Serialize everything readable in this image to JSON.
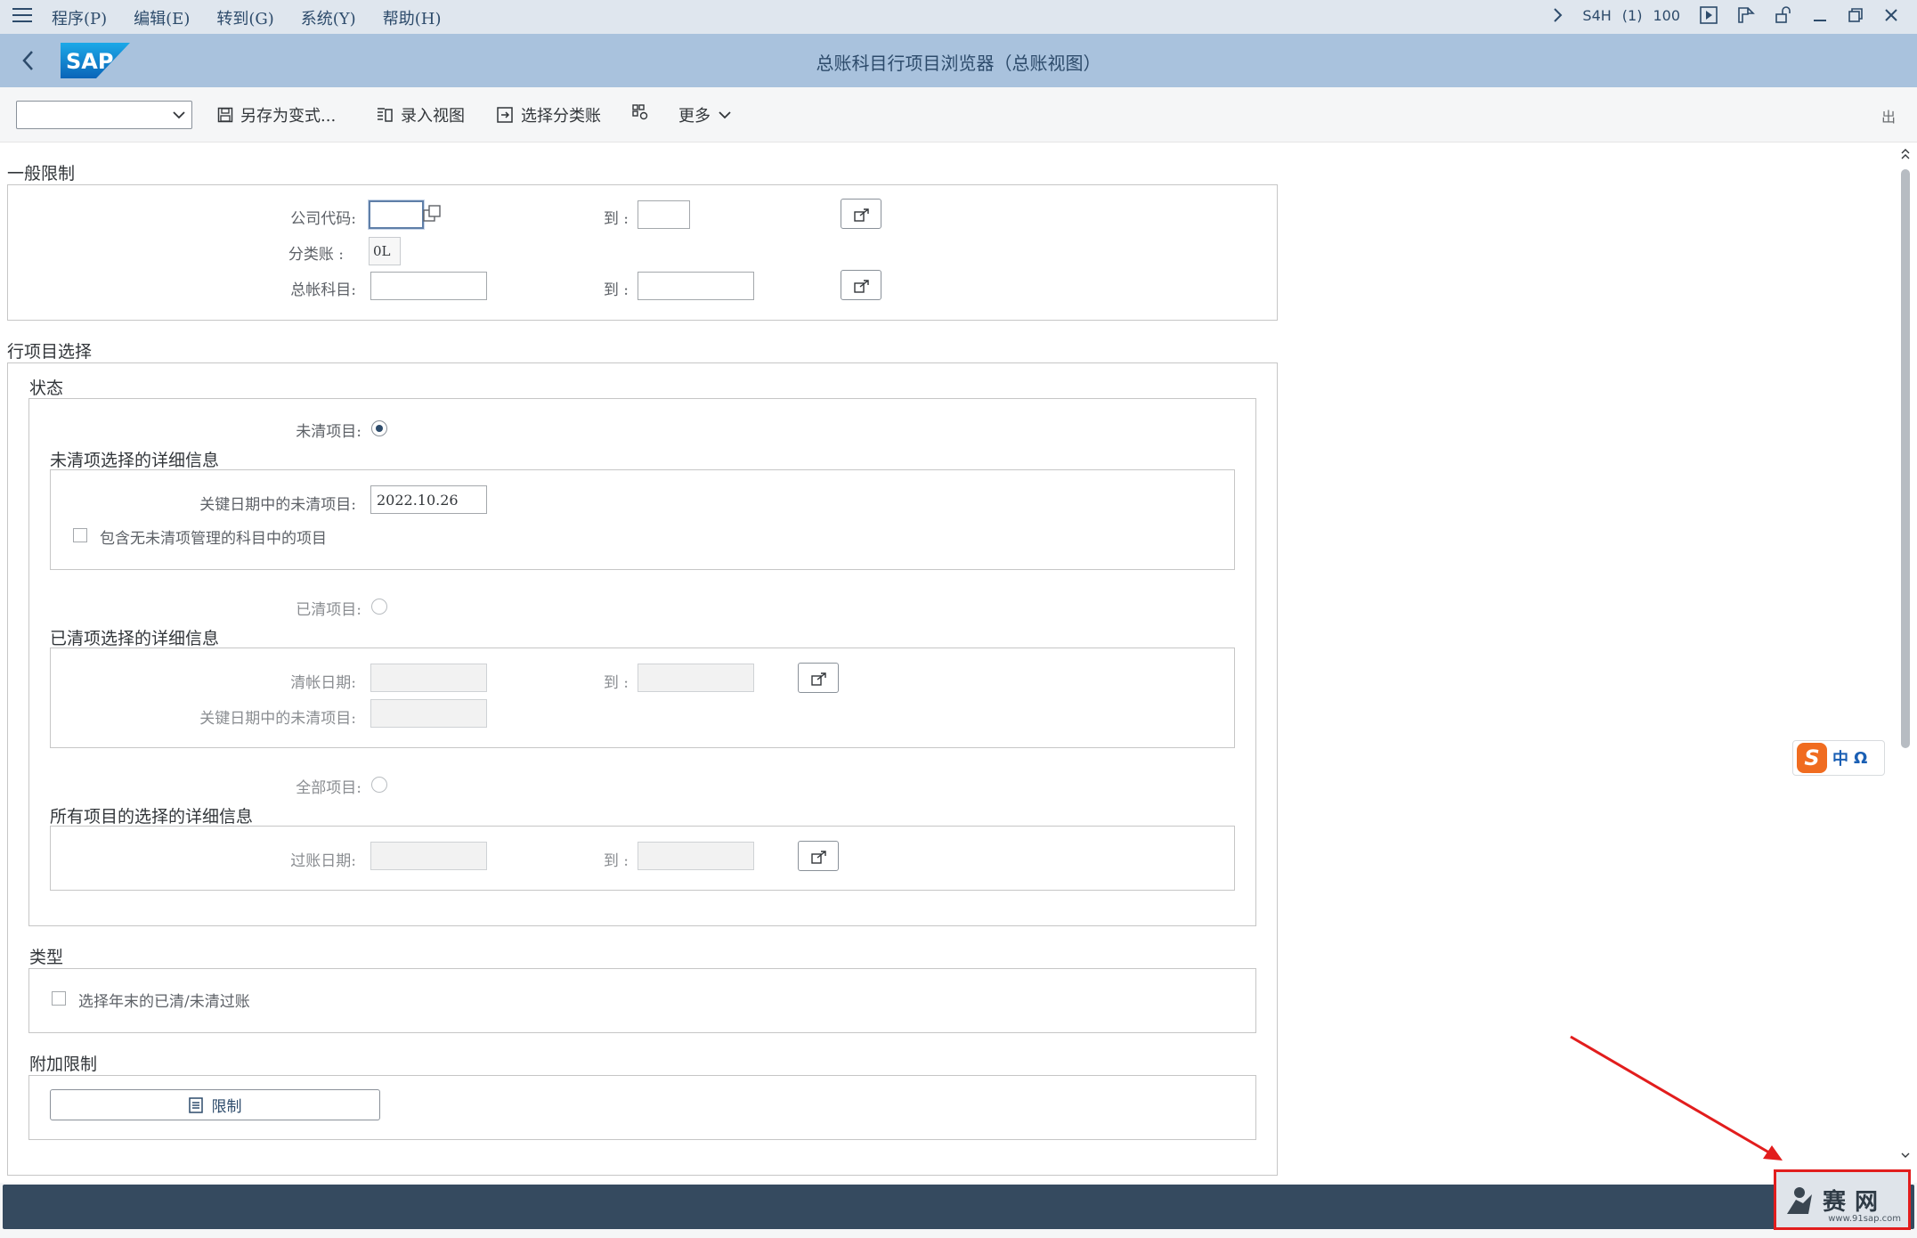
{
  "menubar": {
    "items": [
      "程序(P)",
      "编辑(E)",
      "转到(G)",
      "系统(Y)",
      "帮助(H)"
    ],
    "system": "S4H",
    "session": "(1)",
    "client": "100"
  },
  "header": {
    "logo": "SAP",
    "title": "总账科目行项目浏览器（总账视图）"
  },
  "toolbar": {
    "variant_value": "",
    "save_as_variant": "另存为变式...",
    "entry_view": "录入视图",
    "select_ledger": "选择分类账",
    "more": "更多",
    "exit": "出"
  },
  "general": {
    "title": "一般限制",
    "company_code_label": "公司代码:",
    "company_code_from": "",
    "company_code_to": "",
    "ledger_label": "分类账 :",
    "ledger_value": "0L",
    "gl_account_label": "总帐科目:",
    "gl_account_from": "",
    "gl_account_to": "",
    "to_label": "到 :"
  },
  "line_items": {
    "title": "行项目选择",
    "status_title": "状态",
    "open_items_label": "未清项目:",
    "open_details_title": "未清项选择的详细信息",
    "open_key_date_label": "关键日期中的未清项目:",
    "open_key_date_value": "2022.10.26",
    "include_no_oi_label": "包含无未清项管理的科目中的项目",
    "cleared_items_label": "已清项目:",
    "cleared_details_title": "已清项选择的详细信息",
    "clearing_date_label": "清帐日期:",
    "cleared_key_date_label": "关键日期中的未清项目:",
    "all_items_label": "全部项目:",
    "all_details_title": "所有项目的选择的详细信息",
    "posting_date_label": "过账日期:",
    "to_label": "到 :",
    "status_selected": "open"
  },
  "type": {
    "title": "类型",
    "year_end_label": "选择年末的已清/未清过账"
  },
  "additional": {
    "title": "附加限制",
    "restrict_button": "限制"
  },
  "ime": {
    "logo": "S",
    "mode": "中",
    "symbol": "Ω"
  },
  "watermark": {
    "text": "赛",
    "text2": "网",
    "url": "www.91sap.com"
  },
  "colors": {
    "shell_header": "#a9c2dd",
    "menubar": "#dfe6ee",
    "status_bar": "#354a5f",
    "annotation_red": "#e21d1d"
  }
}
